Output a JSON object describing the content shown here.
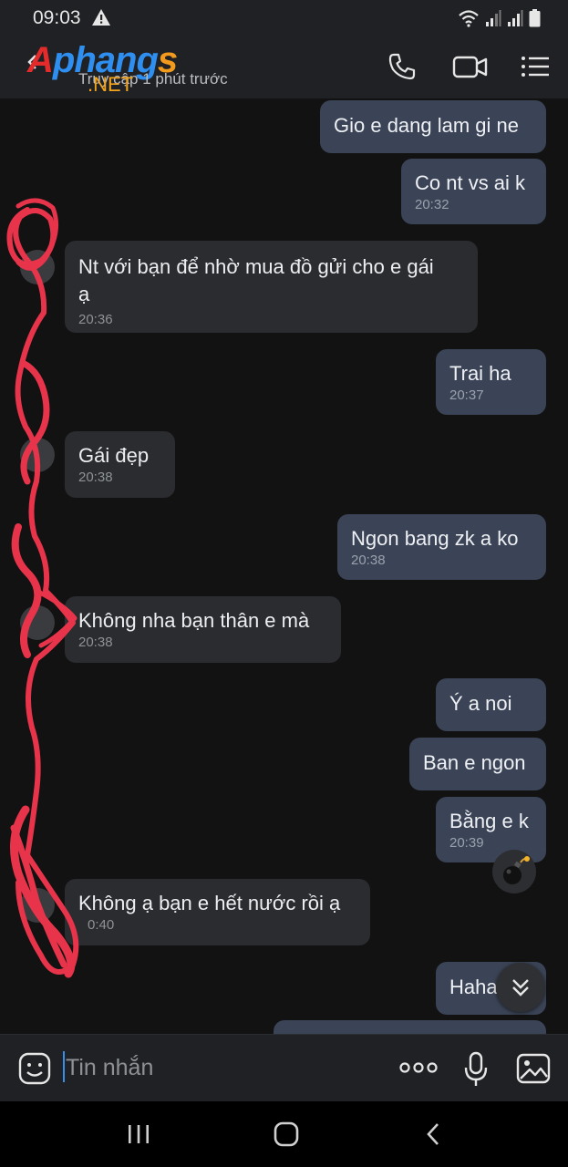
{
  "status_bar": {
    "time": "09:03",
    "icons": [
      "warning-icon",
      "wifi-icon",
      "signal-icon",
      "signal-icon",
      "battery-icon"
    ]
  },
  "header": {
    "watermark": "Aphangs .NET",
    "watermark_parts": [
      "A",
      "phang",
      "s"
    ],
    "watermark_suffix": ".NET",
    "last_seen": "Truy cập 1  phút trước",
    "actions": [
      "phone-icon",
      "video-call-icon",
      "menu-list-icon"
    ]
  },
  "messages": [
    {
      "dir": "out",
      "text": "Gio e dang lam gi ne",
      "time": ""
    },
    {
      "dir": "out",
      "text": "Co nt vs ai k",
      "time": "20:32"
    },
    {
      "dir": "in",
      "text": "Nt với bạn để nhờ mua đồ gửi cho e gái\nạ",
      "time": "20:36"
    },
    {
      "dir": "out",
      "text": "Trai ha",
      "time": "20:37"
    },
    {
      "dir": "in",
      "text": "Gái đẹp",
      "time": "20:38"
    },
    {
      "dir": "out",
      "text": "Ngon bang zk a ko",
      "time": "20:38"
    },
    {
      "dir": "in",
      "text": "Không nha bạn thân e mà",
      "time": "20:38"
    },
    {
      "dir": "out",
      "text": "Ý a noi",
      "time": ""
    },
    {
      "dir": "out",
      "text": "Ban e ngon",
      "time": ""
    },
    {
      "dir": "out",
      "text": "Bằng e k",
      "time": "20:39"
    },
    {
      "dir": "in",
      "text": "Không ạ bạn e hết nước rồi ạ",
      "time": "0:40"
    },
    {
      "dir": "out",
      "text": "Haha",
      "time": ""
    }
  ],
  "composer": {
    "placeholder": "Tin nhắn",
    "icons": [
      "emoji-icon",
      "more-icon",
      "microphone-icon",
      "image-icon"
    ]
  },
  "colors": {
    "background": "#121212",
    "bar": "#202124",
    "outgoing_bubble": "#3b4456",
    "incoming_bubble": "#2b2c2f",
    "redaction": "#e8344a",
    "caret": "#3a8ee8"
  }
}
